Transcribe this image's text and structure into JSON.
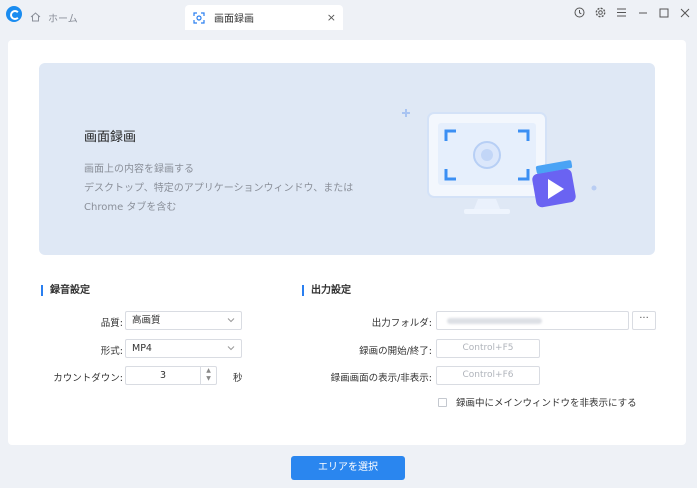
{
  "titlebar": {
    "home_tab_label": "ホーム",
    "active_tab_label": "画面録画",
    "close_glyph": "×",
    "controls": {
      "history": "history-icon",
      "settings": "gear-icon",
      "menu": "menu-icon",
      "minimize": "minimize-icon",
      "maximize": "maximize-icon",
      "close": "close-icon"
    }
  },
  "banner": {
    "title": "画面録画",
    "desc_line1": "画面上の内容を録画する",
    "desc_line2": "デスクトップ、特定のアプリケーションウィンドウ、または",
    "desc_line3": "Chrome タブを含む"
  },
  "audio_settings": {
    "title": "録音設定",
    "quality_label": "品質:",
    "quality_value": "高画質",
    "format_label": "形式:",
    "format_value": "MP4",
    "countdown_label": "カウントダウン:",
    "countdown_value": "3",
    "countdown_unit": "秒"
  },
  "output_settings": {
    "title": "出力設定",
    "folder_label": "出力フォルダ:",
    "folder_button": "···",
    "start_stop_label": "録画の開始/終了:",
    "start_stop_hotkey": "Control+F5",
    "show_hide_label": "録画画面の表示/非表示:",
    "show_hide_hotkey": "Control+F6",
    "hide_window_checkbox": "録画中にメインウィンドウを非表示にする"
  },
  "footer": {
    "select_area_button": "エリアを選択"
  },
  "colors": {
    "accent": "#2a86ef",
    "banner_bg": "#dfe8f5",
    "window_bg": "#eef1f6"
  }
}
